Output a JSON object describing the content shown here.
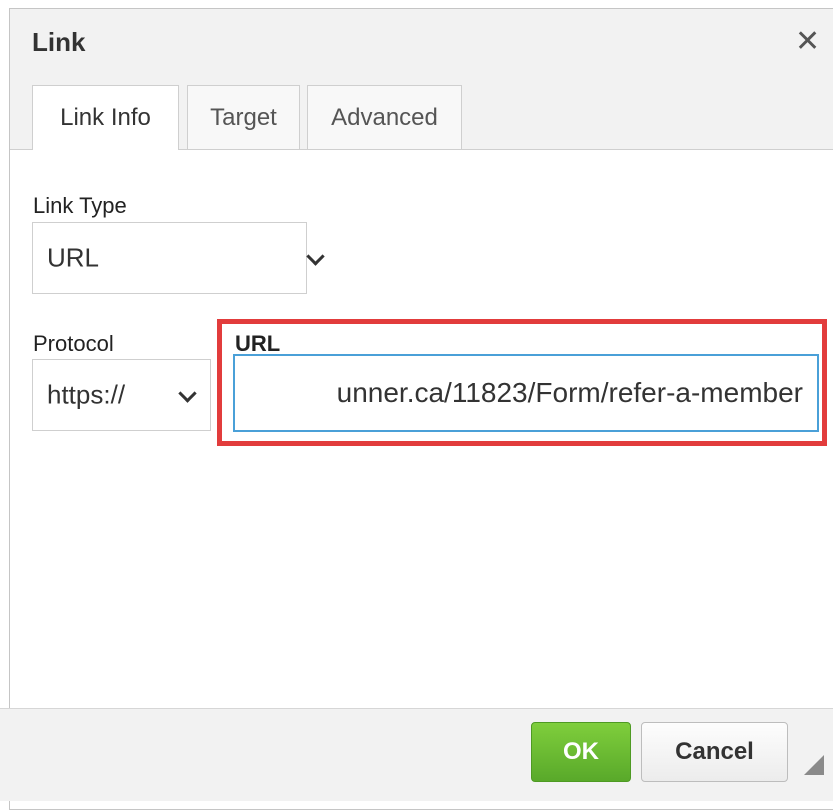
{
  "dialog": {
    "title": "Link",
    "close_glyph": "✕"
  },
  "tabs": [
    {
      "label": "Link Info",
      "active": true
    },
    {
      "label": "Target",
      "active": false
    },
    {
      "label": "Advanced",
      "active": false
    }
  ],
  "link_type": {
    "label": "Link Type",
    "value": "URL"
  },
  "protocol": {
    "label": "Protocol",
    "value": "https://"
  },
  "url": {
    "label": "URL",
    "value": "unner.ca/11823/Form/refer-a-member"
  },
  "footer": {
    "ok_label": "OK",
    "cancel_label": "Cancel"
  },
  "colors": {
    "highlight": "#e23c3c",
    "ok_green": "#6ab632",
    "input_focus": "#4aa0d8"
  }
}
